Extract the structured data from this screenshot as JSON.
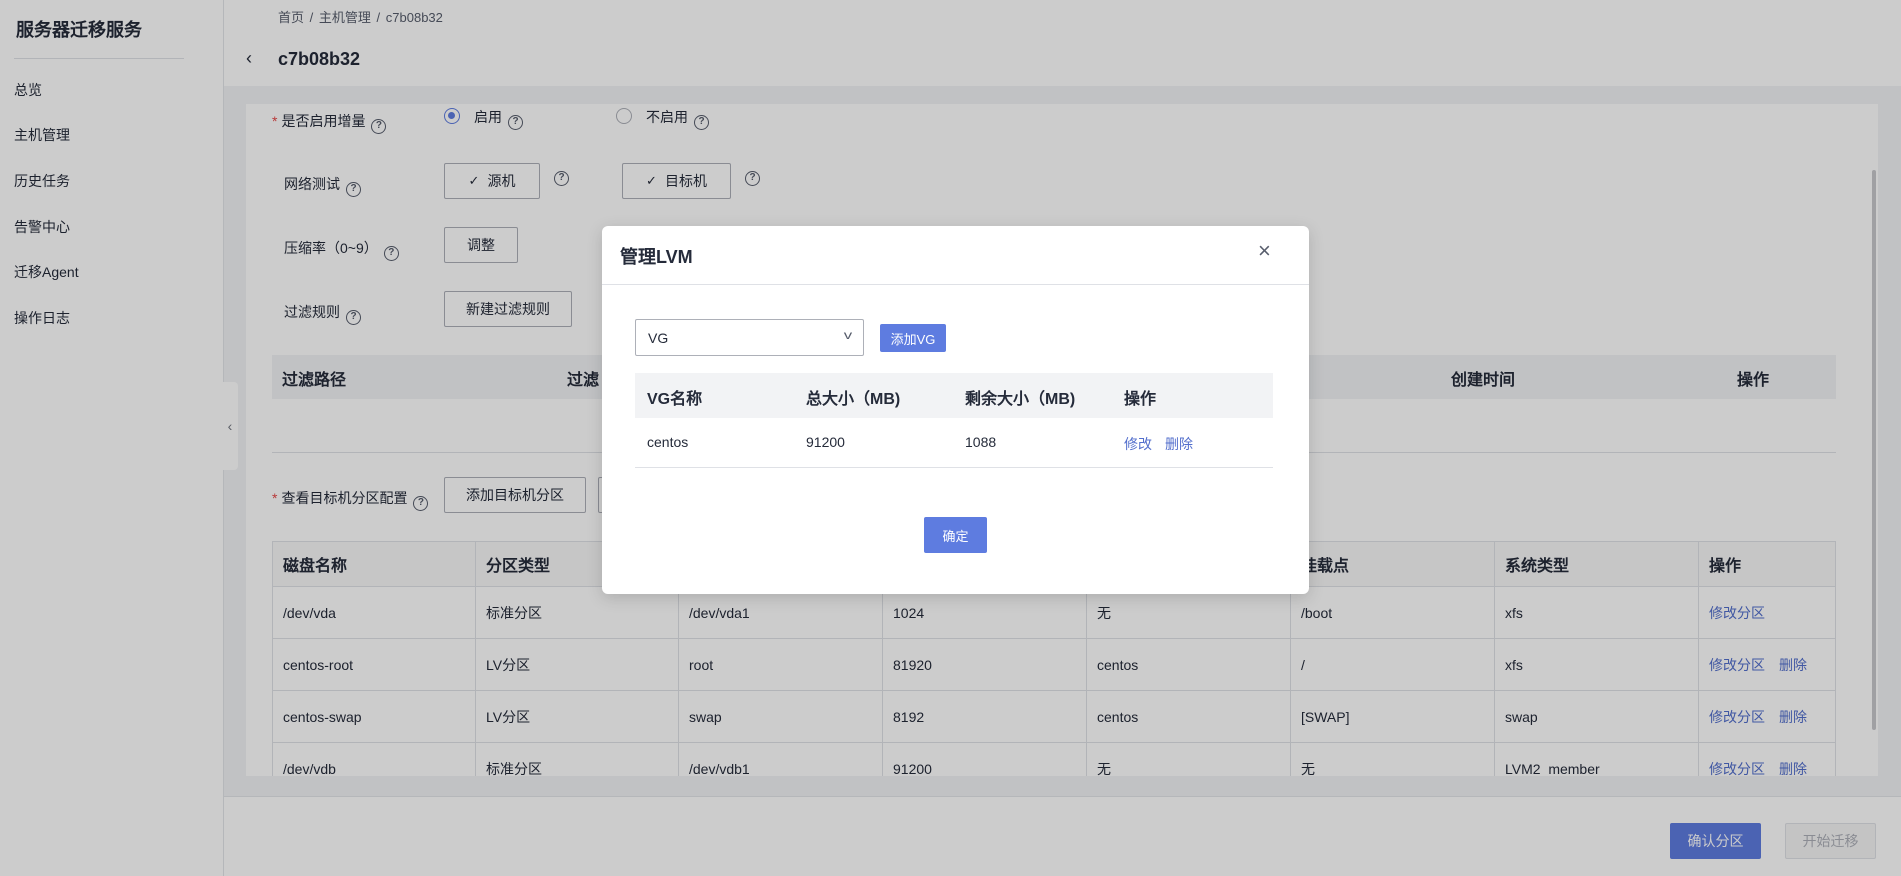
{
  "sidebar": {
    "title": "服务器迁移服务",
    "items": [
      "总览",
      "主机管理",
      "历史任务",
      "告警中心",
      "迁移Agent",
      "操作日志"
    ]
  },
  "header": {
    "breadcrumb": [
      "首页",
      "/",
      "主机管理",
      "/",
      "c7b08b32"
    ],
    "title": "c7b08b32"
  },
  "form": {
    "incremental_label": "是否启用增量",
    "enable_label": "启用",
    "disable_label": "不启用",
    "network_label": "网络测试",
    "source_btn": "源机",
    "target_btn": "目标机",
    "compress_label": "压缩率（0~9）",
    "adjust_btn": "调整",
    "filter_label": "过滤规则",
    "new_filter_btn": "新建过滤规则",
    "filter_headers": [
      "过滤路径",
      "过滤",
      "创建时间",
      "操作"
    ],
    "partition_label": "查看目标机分区配置",
    "add_partition_btn": "添加目标机分区"
  },
  "partition_table": {
    "headers": [
      "磁盘名称",
      "分区类型",
      "",
      "",
      "",
      "挂载点",
      "系统类型",
      "操作"
    ],
    "rows": [
      [
        "/dev/vda",
        "标准分区",
        "/dev/vda1",
        "1024",
        "无",
        "/boot",
        "xfs"
      ],
      [
        "centos-root",
        "LV分区",
        "root",
        "81920",
        "centos",
        "/",
        "xfs"
      ],
      [
        "centos-swap",
        "LV分区",
        "swap",
        "8192",
        "centos",
        "[SWAP]",
        "swap"
      ],
      [
        "/dev/vdb",
        "标准分区",
        "/dev/vdb1",
        "91200",
        "无",
        "无",
        "LVM2_member"
      ]
    ],
    "modify_link": "修改分区",
    "delete_link": "删除"
  },
  "bottom": {
    "confirm_partition": "确认分区",
    "start_migration": "开始迁移"
  },
  "modal": {
    "title": "管理LVM",
    "select_value": "VG",
    "add_vg": "添加VG",
    "headers": [
      "VG名称",
      "总大小（MB)",
      "剩余大小（MB)",
      "操作"
    ],
    "row": [
      "centos",
      "91200",
      "1088"
    ],
    "edit_link": "修改",
    "delete_link": "删除",
    "confirm": "确定"
  },
  "colors": {
    "primary": "#5e7ce0",
    "link": "#526ecc",
    "required": "#e64848"
  }
}
